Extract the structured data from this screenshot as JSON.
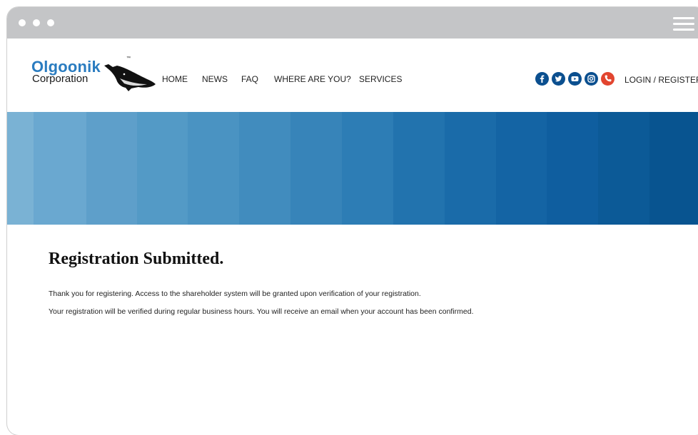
{
  "browser": {
    "menu_icon": "hamburger-menu-icon",
    "window_dots": [
      "window-dot",
      "window-dot",
      "window-dot"
    ]
  },
  "logo": {
    "name": "Olgoonik",
    "subtitle": "Corporation",
    "trademark": "™",
    "brand_color": "#2a7cc0",
    "icon": "whale-logo-icon"
  },
  "nav": {
    "items": [
      "HOME",
      "NEWS",
      "FAQ",
      "WHERE ARE YOU?",
      "SERVICES"
    ]
  },
  "social": {
    "icons": [
      "facebook-icon",
      "twitter-icon",
      "youtube-icon",
      "instagram-icon",
      "phone-icon"
    ],
    "color": "#0b4f8f",
    "phone_color": "#e2452f"
  },
  "account": {
    "login_label": "LOGIN / REGISTER"
  },
  "banner": {
    "colors": [
      "#7ab2d4",
      "#6aa8d0",
      "#5e9fca",
      "#539ac6",
      "#4a93c2",
      "#418cbe",
      "#3784b9",
      "#2d7db5",
      "#2273ae",
      "#1a6ba9",
      "#1464a4",
      "#0f5e9f",
      "#0c5a97",
      "#085490"
    ]
  },
  "main": {
    "heading": "Registration Submitted.",
    "paragraphs": [
      "Thank you for registering. Access to the shareholder system will be granted upon verification of your registration.",
      "Your registration will be verified during regular business hours. You will receive an email when your account has been confirmed."
    ]
  }
}
